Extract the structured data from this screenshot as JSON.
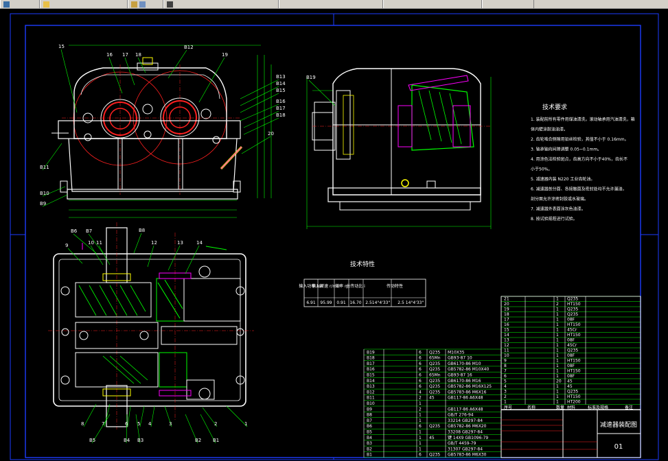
{
  "taskbar": {
    "items": [
      "",
      "",
      "",
      "",
      "",
      "",
      ""
    ]
  },
  "drawing": {
    "title_block": {
      "name": "减速器装配图",
      "number": "01"
    },
    "tech_req_title": "技术要求",
    "tech_req_lines": [
      "1. 装配前所有零件用煤油清洗，滚动轴承用汽油清洗，箱",
      "   体内壁涂耐油油漆。",
      "2. 齿轮啮合侧隙用铅丝检验，其值不小于 0.16mm。",
      "3. 轴承轴向间隙调整 0.05~0.1mm。",
      "4. 用涂色法检验斑点，齿高方向不小于40%，齿长不",
      "   小于50%。",
      "5. 减速器内装 N220 工业齿轮油。",
      "6. 减速器剖分面、各接触面及密封处均不允许漏油，",
      "   剖分面允许涂密封胶或水玻璃。",
      "7. 减速器外表面涂灰色油漆。",
      "8. 按试验规程进行试验。"
    ],
    "tech_char_title": "技术特性",
    "tech_char_headers": [
      "输入功率 kW",
      "输入转速 r/min",
      "效率 η",
      "总传动比 i",
      "传动特性"
    ],
    "tech_char_values": [
      "6.91",
      "95.99",
      "0.91",
      "16.70",
      "2.5",
      "14°4'33\"",
      "2.5",
      "14°4'33\""
    ],
    "callouts": [
      "15",
      "16",
      "17",
      "18",
      "B12",
      "19",
      "B13",
      "B14",
      "B15",
      "B16",
      "B17",
      "B18",
      "20",
      "B11",
      "B10",
      "B9",
      "B19",
      "B6",
      "B7",
      "B8",
      "10",
      "11",
      "12",
      "13",
      "14",
      "9",
      "8",
      "7",
      "B5",
      "B4",
      "B3",
      "6",
      "5",
      "4",
      "3",
      "2",
      "B2",
      "B1",
      "1"
    ],
    "bom_left": [
      [
        "B19",
        "",
        "6",
        "Q235",
        "M10X35"
      ],
      [
        "B18",
        "",
        "6",
        "65Mn",
        "GB93-87 10"
      ],
      [
        "B17",
        "",
        "6",
        "Q235",
        "GB6170-86 M10"
      ],
      [
        "B16",
        "",
        "6",
        "Q235",
        "GB5782-86 M10X40"
      ],
      [
        "B15",
        "",
        "6",
        "65Mn",
        "GB93-87 16"
      ],
      [
        "B14",
        "",
        "6",
        "Q235",
        "GB6170-86 M16"
      ],
      [
        "B13",
        "",
        "6",
        "Q235",
        "GB5782-86 M16X125"
      ],
      [
        "B12",
        "",
        "4",
        "Q235",
        "GB5783-86 M6X16"
      ],
      [
        "B11",
        "",
        "2",
        "45",
        "GB117-86 A6X48"
      ],
      [
        "B10",
        "",
        "1",
        "",
        ""
      ],
      [
        "B9",
        "",
        "2",
        "",
        "GB117-86 A6X48"
      ],
      [
        "B8",
        "",
        "1",
        "",
        "GB/T 276-94"
      ],
      [
        "B7",
        "",
        "1",
        "",
        "33214 GB297-84"
      ],
      [
        "B6",
        "",
        "6",
        "Q235",
        "GB5782-86 M6X20"
      ],
      [
        "B5",
        "",
        "1",
        "",
        "33208 GB297-84"
      ],
      [
        "B4",
        "",
        "1",
        "45",
        "键 14X9 GB1096-79"
      ],
      [
        "B3",
        "",
        "1",
        "",
        "GB/T 4459-79"
      ],
      [
        "B2",
        "",
        "1",
        "",
        "31307 GB297-84"
      ],
      [
        "B1",
        "",
        "6",
        "Q235",
        "GB5783-86 M6X30"
      ]
    ],
    "bom_right": [
      [
        "21",
        "",
        "1",
        "Q235",
        ""
      ],
      [
        "20",
        "",
        "2",
        "HT150",
        ""
      ],
      [
        "19",
        "",
        "1",
        "Q235",
        ""
      ],
      [
        "18",
        "",
        "1",
        "Q235",
        ""
      ],
      [
        "17",
        "",
        "1",
        "08F",
        ""
      ],
      [
        "16",
        "",
        "1",
        "HT150",
        ""
      ],
      [
        "15",
        "",
        "1",
        "45Cr",
        ""
      ],
      [
        "14",
        "",
        "1",
        "HT150",
        ""
      ],
      [
        "13",
        "",
        "1",
        "08F",
        ""
      ],
      [
        "12",
        "",
        "1",
        "45Cr",
        ""
      ],
      [
        "11",
        "",
        "1",
        "Q235",
        ""
      ],
      [
        "10",
        "",
        "1",
        "08F",
        ""
      ],
      [
        "9",
        "",
        "1",
        "HT150",
        ""
      ],
      [
        "8",
        "",
        "1",
        "08F",
        ""
      ],
      [
        "7",
        "",
        "1",
        "HT150",
        ""
      ],
      [
        "6",
        "",
        "1",
        "08F",
        ""
      ],
      [
        "5",
        "",
        "20",
        "45",
        ""
      ],
      [
        "4",
        "",
        "1",
        "45",
        ""
      ],
      [
        "3",
        "",
        "1",
        "Q235",
        ""
      ],
      [
        "2",
        "",
        "1",
        "HT150",
        ""
      ],
      [
        "1",
        "",
        "1",
        "HT200",
        ""
      ]
    ],
    "bom_header": [
      "序号",
      "名称",
      "数量",
      "材料",
      "标准及规格",
      "备注"
    ],
    "colors": {
      "frame_blue": "#1c3cff",
      "line_white": "#ffffff",
      "line_green": "#00ff00",
      "line_red": "#ff2020",
      "line_yellow": "#ffff00",
      "line_magenta": "#ff00ff",
      "line_cyan": "#00ffff"
    }
  }
}
